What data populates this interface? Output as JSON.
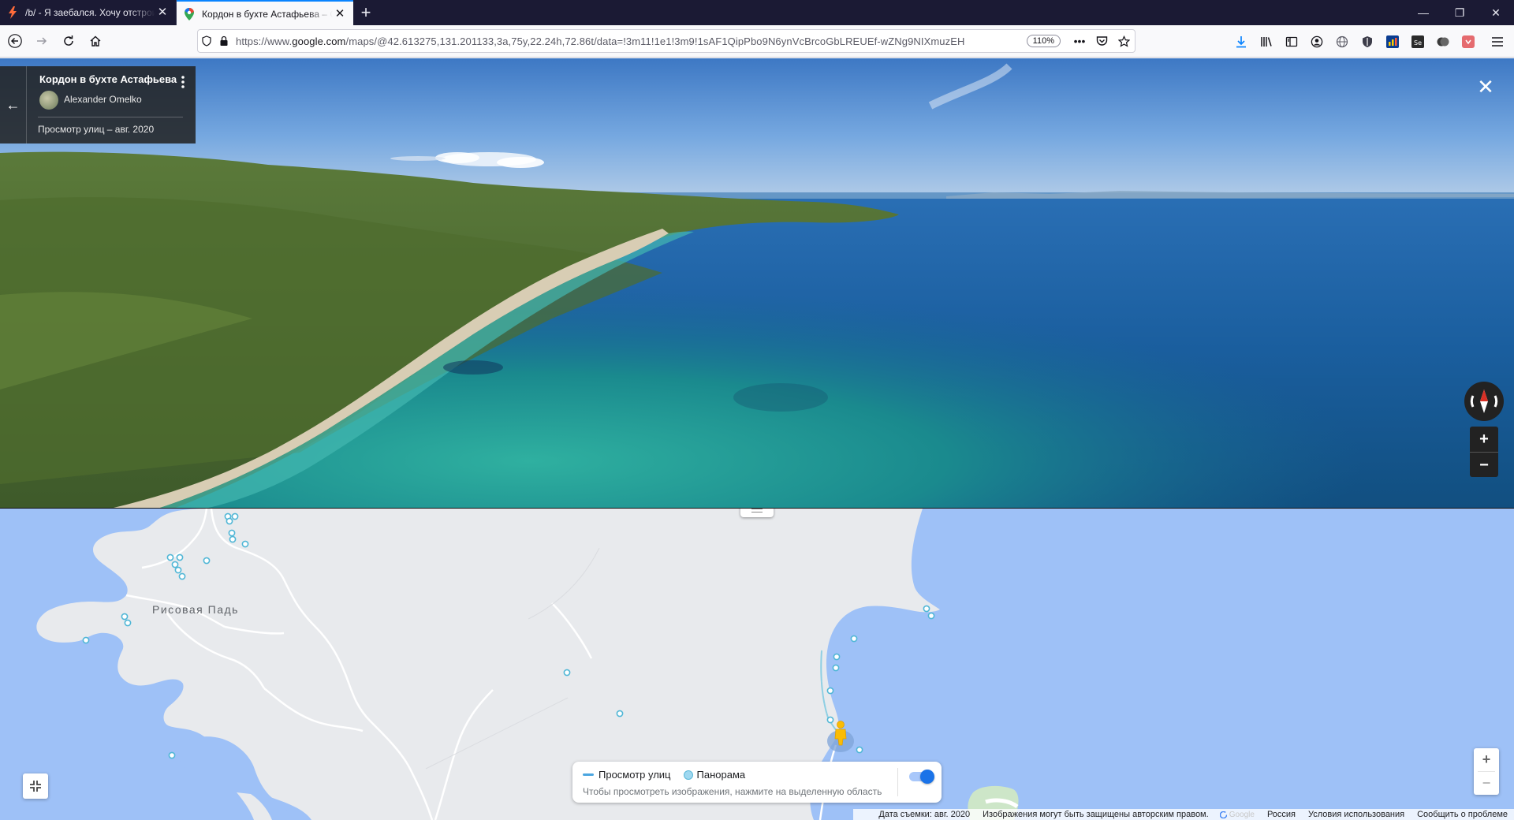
{
  "tabs": [
    {
      "title": "/b/ - Я заебался. Хочу отстроиться",
      "favicon": "lightning-icon",
      "close": "✕"
    },
    {
      "title": "Кордон в бухте Астафьева – Google Карты",
      "favicon": "google-maps-pin-icon",
      "close": "✕"
    }
  ],
  "new_tab": "+",
  "window_controls": {
    "minimize": "—",
    "maximize": "❐",
    "close": "✕"
  },
  "address_bar": {
    "url_prefix": "https://www.",
    "url_host": "google.com",
    "url_rest": "/maps/@42.613275,131.201133,3a,75y,22.24h,72.86t/data=!3m11!1e1!3m9!1sAF1QipPbo9N6ynVcBrcoGbLREUEf-wZNg9NIXmuzEH",
    "zoom": "110%",
    "page_actions": "•••"
  },
  "streetview": {
    "place_title": "Кордон в бухте Астафьева",
    "author": "Alexander Omelko",
    "capture_date": "Просмотр улиц – авг. 2020",
    "back": "←",
    "close": "✕",
    "zoom_in": "+",
    "zoom_out": "−"
  },
  "map": {
    "town_label": "Рисовая Падь",
    "zoom_in": "+",
    "zoom_out": "−",
    "legend": {
      "street_view": "Просмотр улиц",
      "panorama": "Панорама",
      "hint": "Чтобы просмотреть изображения, нажмите на выделенную область"
    },
    "footer": {
      "capture_date": "Дата съемки: авг. 2020",
      "copyright": "Изображения могут быть защищены авторским правом.",
      "google": "Google",
      "country": "Россия",
      "terms": "Условия использования",
      "report": "Сообщить о проблеме"
    }
  },
  "colors": {
    "accent": "#0a84ff",
    "tabbar_bg": "#1b1a34",
    "water": "#9ec1f7",
    "land": "#e8eaed",
    "pegman": "#fbbc04"
  }
}
